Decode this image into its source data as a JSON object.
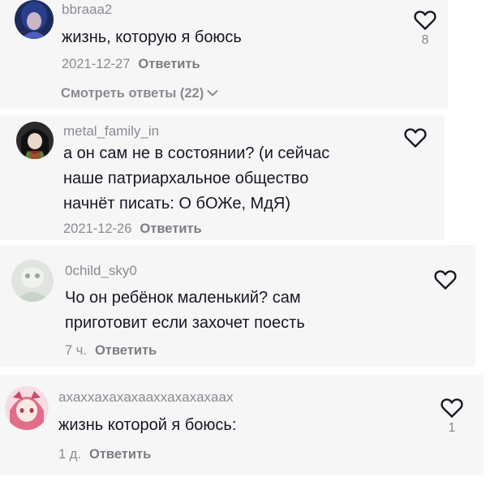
{
  "comments": [
    {
      "username": "bbraaa2",
      "text": "жизнь, которую я боюсь",
      "date": "2021-12-27",
      "reply_label": "Ответить",
      "likes": "8",
      "view_replies": "Смотреть ответы (22)"
    },
    {
      "username": "metal_family_in",
      "text": "а он сам не в состоянии? (и сейчас\nнаше патриархальное общество\nначнёт писать: О бОЖе, МдЯ)",
      "date": "2021-12-26",
      "reply_label": "Ответить",
      "likes": ""
    },
    {
      "username": "0child_sky0",
      "text": "Чо он ребёнок маленький? сам\nприготовит если захочет поесть",
      "date": "7 ч.",
      "reply_label": "Ответить",
      "likes": ""
    },
    {
      "username": "axaxxaxaxaxaaxxaxaxaxaax",
      "text": "жизнь которой я боюсь:",
      "date": "1 д.",
      "reply_label": "Ответить",
      "likes": "1"
    }
  ],
  "icons": {
    "like": "heart-outline-icon",
    "expand": "chevron-down-icon"
  },
  "colors": {
    "card_bg": "#f6f6f7",
    "text": "#161823",
    "secondary": "#8a8b91"
  }
}
